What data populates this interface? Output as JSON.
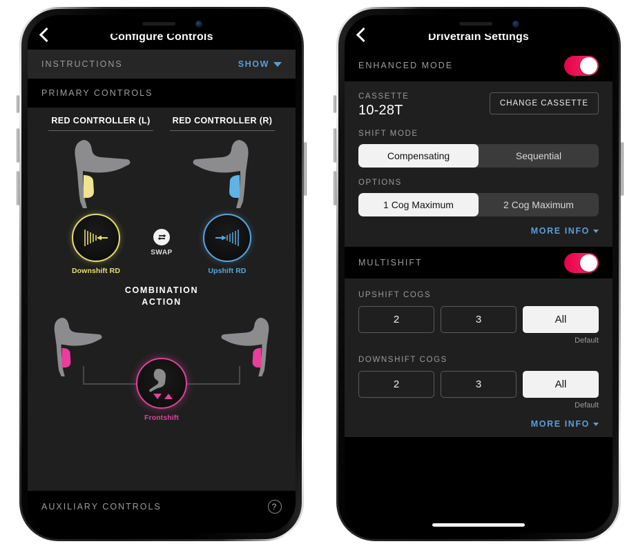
{
  "left_phone": {
    "nav": {
      "title": "Configure Controls",
      "back_icon": "back-chevron-icon"
    },
    "instructions": {
      "label": "INSTRUCTIONS",
      "action": "SHOW"
    },
    "primary_controls_label": "PRIMARY CONTROLS",
    "controllers": [
      {
        "title": "RED CONTROLLER (L)",
        "accent": "#e8e06a",
        "action_label": "Downshift RD",
        "arrow": "left"
      },
      {
        "title": "RED CONTROLLER (R)",
        "accent": "#55a8e0",
        "action_label": "Upshift RD",
        "arrow": "right"
      }
    ],
    "swap": {
      "label": "SWAP",
      "icon": "swap-arrows-icon"
    },
    "combination": {
      "title_line1": "COMBINATION",
      "title_line2": "ACTION",
      "action_label": "Frontshift",
      "accent": "#e0439b"
    },
    "auxiliary": {
      "label": "AUXILIARY CONTROLS",
      "help_icon": "question-mark-icon",
      "help_glyph": "?"
    }
  },
  "right_phone": {
    "nav": {
      "title": "Drivetrain Settings",
      "back_icon": "back-chevron-icon"
    },
    "enhanced_mode": {
      "label": "ENHANCED MODE",
      "enabled": true
    },
    "cassette": {
      "label": "CASSETTE",
      "value": "10-28T",
      "change_button": "CHANGE CASSETTE"
    },
    "shift_mode": {
      "label": "SHIFT MODE",
      "options": [
        "Compensating",
        "Sequential"
      ],
      "selected": "Compensating"
    },
    "options": {
      "label": "OPTIONS",
      "items": [
        "1 Cog Maximum",
        "2 Cog Maximum"
      ],
      "selected": "1 Cog Maximum"
    },
    "more_info_top": "MORE INFO",
    "multishift": {
      "label": "MULTISHIFT",
      "enabled": true
    },
    "upshift_cogs": {
      "label": "UPSHIFT COGS",
      "options": [
        "2",
        "3",
        "All"
      ],
      "selected": "All",
      "default_note": "Default"
    },
    "downshift_cogs": {
      "label": "DOWNSHIFT COGS",
      "options": [
        "2",
        "3",
        "All"
      ],
      "selected": "All",
      "default_note": "Default"
    },
    "more_info_bottom": "MORE INFO",
    "toggle_color": "#f0376d"
  }
}
